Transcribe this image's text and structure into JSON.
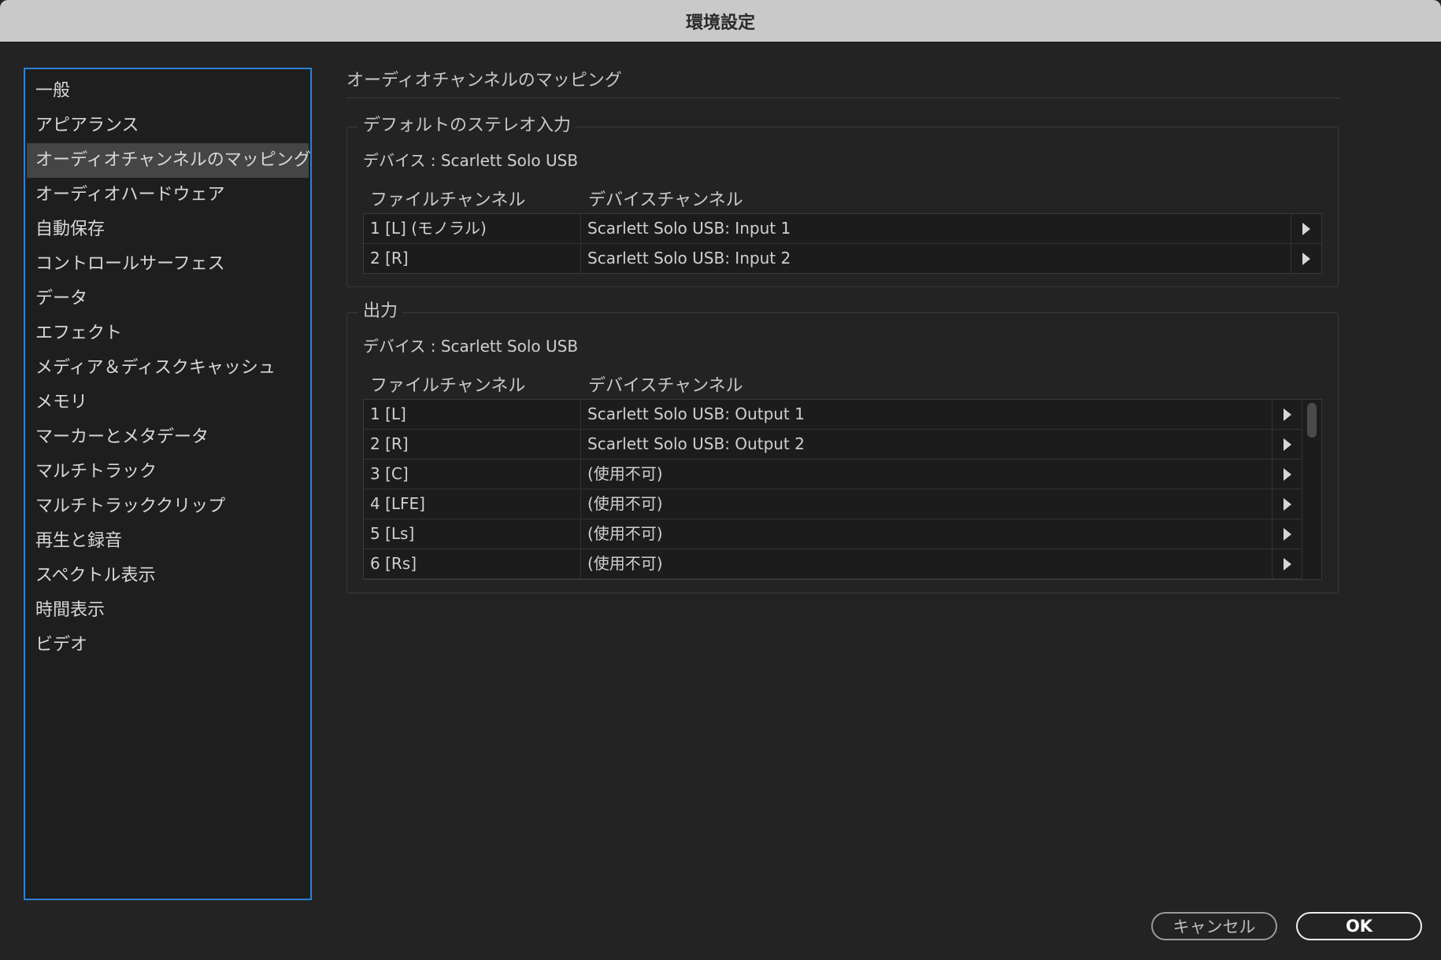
{
  "window": {
    "title": "環境設定"
  },
  "sidebar": {
    "items": [
      {
        "label": "一般"
      },
      {
        "label": "アピアランス"
      },
      {
        "label": "オーディオチャンネルのマッピング",
        "selected": true
      },
      {
        "label": "オーディオハードウェア"
      },
      {
        "label": "自動保存"
      },
      {
        "label": "コントロールサーフェス"
      },
      {
        "label": "データ"
      },
      {
        "label": "エフェクト"
      },
      {
        "label": "メディア＆ディスクキャッシュ"
      },
      {
        "label": "メモリ"
      },
      {
        "label": "マーカーとメタデータ"
      },
      {
        "label": "マルチトラック"
      },
      {
        "label": "マルチトラッククリップ"
      },
      {
        "label": "再生と録音"
      },
      {
        "label": "スペクトル表示"
      },
      {
        "label": "時間表示"
      },
      {
        "label": "ビデオ"
      }
    ]
  },
  "main": {
    "title": "オーディオチャンネルのマッピング",
    "stereo_input": {
      "legend": "デフォルトのステレオ入力",
      "device": "デバイス : Scarlett Solo USB",
      "col_file": "ファイルチャンネル",
      "col_device": "デバイスチャンネル",
      "rows": [
        {
          "file": "1 [L] (モノラル)",
          "device": "Scarlett Solo USB: Input 1"
        },
        {
          "file": "2 [R]",
          "device": "Scarlett Solo USB: Input 2"
        }
      ]
    },
    "output": {
      "legend": "出力",
      "device": "デバイス : Scarlett Solo USB",
      "col_file": "ファイルチャンネル",
      "col_device": "デバイスチャンネル",
      "rows": [
        {
          "file": "1 [L]",
          "device": "Scarlett Solo USB: Output 1"
        },
        {
          "file": "2 [R]",
          "device": "Scarlett Solo USB: Output 2"
        },
        {
          "file": "3 [C]",
          "device": "(使用不可)"
        },
        {
          "file": "4 [LFE]",
          "device": "(使用不可)"
        },
        {
          "file": "5 [Ls]",
          "device": "(使用不可)"
        },
        {
          "file": "6 [Rs]",
          "device": "(使用不可)"
        }
      ]
    }
  },
  "buttons": {
    "cancel": "キャンセル",
    "ok": "OK"
  },
  "colors": {
    "accent": "#2f7fd6",
    "background": "#232323",
    "selected": "#454545"
  }
}
